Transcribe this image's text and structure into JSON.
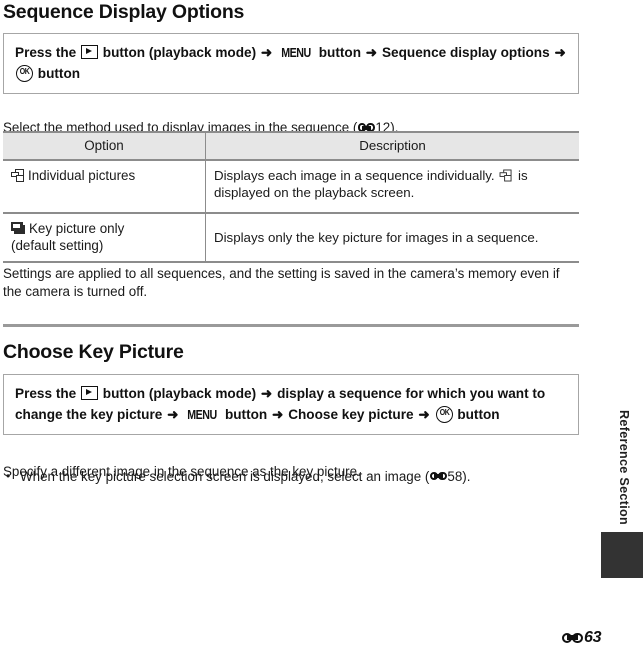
{
  "page": {
    "footer_page_number": "63",
    "side_label": "Reference Section",
    "ref_icon": "reference-mark-icon"
  },
  "sections": [
    {
      "id": "sequence-display-options",
      "title": "Sequence Display Options",
      "instruction": {
        "parts": [
          {
            "type": "text",
            "value": "Press the "
          },
          {
            "type": "icon",
            "value": "playback-button-icon"
          },
          {
            "type": "text",
            "value": " button (playback mode) "
          },
          {
            "type": "icon",
            "value": "arrow-right-icon"
          },
          {
            "type": "icon",
            "value": "menu-button-icon"
          },
          {
            "type": "text",
            "value": " button "
          },
          {
            "type": "icon",
            "value": "arrow-right-icon"
          },
          {
            "type": "text",
            "value": " Sequence display options "
          },
          {
            "type": "icon",
            "value": "arrow-right-icon"
          },
          {
            "type": "icon",
            "value": "ok-button-icon"
          },
          {
            "type": "text",
            "value": " button"
          }
        ],
        "line1_prefix": "Press the",
        "line1_mid1": "button (playback mode)",
        "line1_menu_label": "MENU",
        "line1_mid2": "button",
        "line1_option": "Sequence display options",
        "line2_suffix": "button",
        "arrow": "➜"
      },
      "intro_text_before": "Select the method used to display images in the sequence (",
      "intro_ref_page": "12",
      "intro_text_after": ").",
      "table": {
        "headers": [
          "Option",
          "Description"
        ],
        "rows": [
          {
            "icon": "individual-pictures-icon",
            "option": "Individual pictures",
            "option_sub": "",
            "desc_before": "Displays each image in a sequence individually. ",
            "desc_icon": "individual-pictures-icon",
            "desc_after": " is displayed on the playback screen."
          },
          {
            "icon": "key-picture-icon",
            "option": "Key picture only",
            "option_sub": "(default setting)",
            "desc_before": "Displays only the key picture for images in a sequence.",
            "desc_icon": "",
            "desc_after": ""
          }
        ]
      },
      "note": "Settings are applied to all sequences, and the setting is saved in the camera’s memory even if the camera is turned off."
    },
    {
      "id": "choose-key-picture",
      "title": "Choose Key Picture",
      "instruction": {
        "line1_prefix": "Press the",
        "line1_mid1": "button (playback mode)",
        "line1_option": "display a sequence for which you want to",
        "line2_prefix": "change the key picture",
        "line2_menu_label": "MENU",
        "line2_mid": "button",
        "line2_option": "Choose key picture",
        "line2_suffix": "button",
        "arrow": "➜"
      },
      "body": "Specify a different image in the sequence as the key picture.",
      "bullets": [
        {
          "text_before": "When the key picture selection screen is displayed, select an image (",
          "ref_page": "58",
          "text_after": ")."
        }
      ]
    }
  ],
  "colors": {
    "text": "#1a1a1a",
    "box_border": "#a6a6a6",
    "table_rule": "#8c8c8c",
    "table_header_bg": "#e6e6e6",
    "side_tab": "#333333"
  }
}
